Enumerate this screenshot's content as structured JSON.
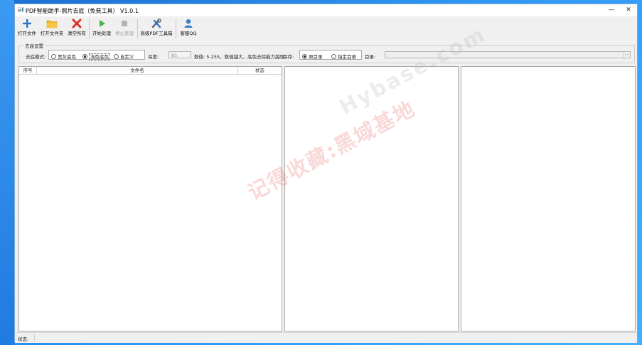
{
  "window": {
    "title": "PDF智能助手-照片去底（免费工具） V1.0.1",
    "minimize": "—",
    "close": "✕"
  },
  "toolbar": {
    "open_file": "打开文件",
    "open_folder": "打开文件夹",
    "clear_all": "清空所有",
    "start": "开始处理",
    "stop": "停止处理",
    "advanced": "高级PDF工具箱",
    "support_qq": "客服QQ"
  },
  "settings": {
    "group_title": "去底设置",
    "mode_label": "去底模式:",
    "mode_options": [
      "黑灰底色",
      "浅色底色",
      "自定义"
    ],
    "mode_selected": "浅色底色",
    "depth_label": "深度:",
    "depth_value": "85",
    "depth_hint": "数值: 5-255，数值越大，底色去除能力越强",
    "save_label": "保存:",
    "save_options": [
      "原目录",
      "指定目录"
    ],
    "save_selected": "原目录",
    "dir_label": "目录:",
    "dir_value": "",
    "browse": "…"
  },
  "file_table": {
    "columns": [
      "序号",
      "文件名",
      "状态"
    ],
    "rows": []
  },
  "status_bar": {
    "label": "状态:"
  },
  "watermark": {
    "cn": "记得收藏:黑域基地",
    "en": "Hybase.com"
  },
  "colors": {
    "accent": "#2b74c7",
    "close_red": "#d9342b",
    "play_green": "#4caf50",
    "folder": "#e9a825"
  }
}
